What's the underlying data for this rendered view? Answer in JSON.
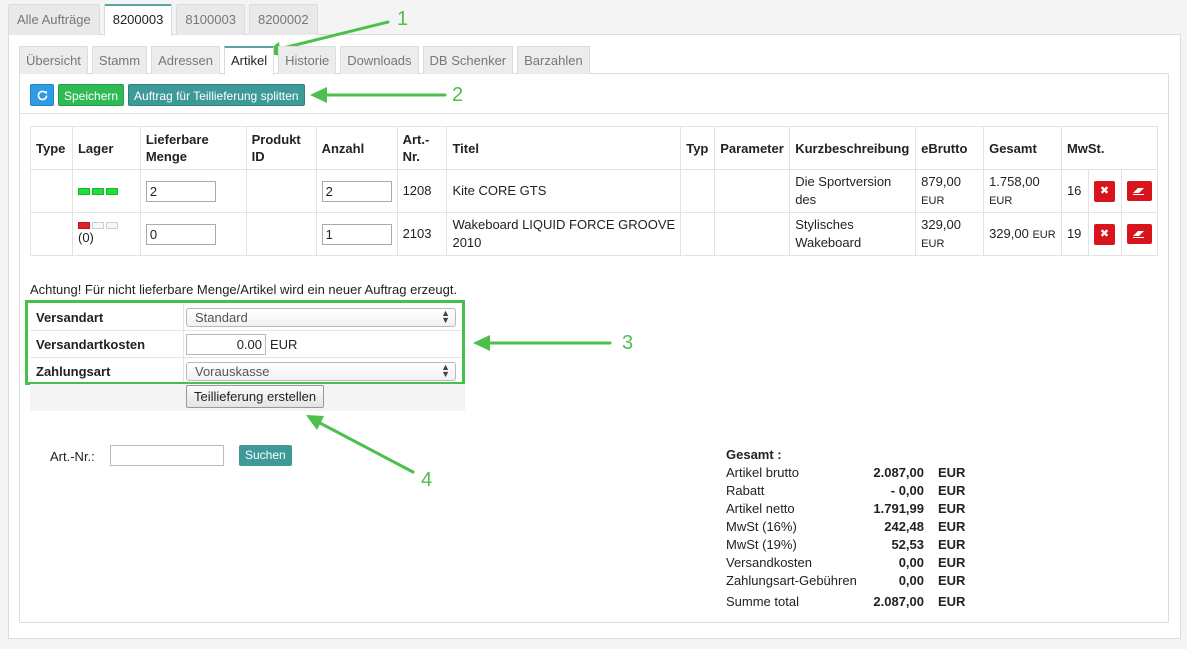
{
  "top_tabs": [
    "Alle Aufträge",
    "8200003",
    "8100003",
    "8200002"
  ],
  "sub_tabs": [
    "Übersicht",
    "Stamm",
    "Adressen",
    "Artikel",
    "Historie",
    "Downloads",
    "DB Schenker",
    "Barzahlen"
  ],
  "toolbar": {
    "save_label": "Speichern",
    "split_label": "Auftrag für Teillieferung splitten",
    "refresh_icon": "refresh-icon"
  },
  "table": {
    "headers": [
      "Type",
      "Lager",
      "Lieferbare Menge",
      "Produkt ID",
      "Anzahl",
      "Art.-Nr.",
      "Titel",
      "Typ",
      "Parameter",
      "Kurzbeschreibung",
      "eBrutto",
      "Gesamt",
      "MwSt."
    ],
    "rows": [
      {
        "lager_text": "",
        "lieferbar": "2",
        "anzahl": "2",
        "artnr": "1208",
        "titel": "Kite CORE GTS",
        "kurz": "Die Sportversion des",
        "ebrutto": "879,00",
        "ebrutto_cur": "EUR",
        "gesamt": "1.758,00",
        "gesamt_cur": "EUR",
        "mwst": "16"
      },
      {
        "lager_text": "(0)",
        "lieferbar": "0",
        "anzahl": "1",
        "artnr": "2103",
        "titel": "Wakeboard LIQUID FORCE GROOVE 2010",
        "kurz": "Stylisches Wakeboard",
        "ebrutto": "329,00",
        "ebrutto_cur": "EUR",
        "gesamt": "329,00",
        "gesamt_cur": "EUR",
        "mwst": "19"
      }
    ]
  },
  "notice": "Achtung! Für nicht lieferbare Menge/Artikel wird ein neuer Auftrag erzeugt.",
  "form": {
    "versandart_label": "Versandart",
    "versandart_value": "Standard",
    "kosten_label": "Versandartkosten",
    "kosten_value": "0.00",
    "kosten_cur": "EUR",
    "zahlungsart_label": "Zahlungsart",
    "zahlungsart_value": "Vorauskasse",
    "create_button": "Teillieferung erstellen"
  },
  "search": {
    "label": "Art.-Nr.:",
    "button": "Suchen",
    "value": ""
  },
  "totals": {
    "head": "Gesamt :",
    "rows": [
      {
        "label": "Artikel brutto",
        "value": "2.087,00",
        "cur": "EUR"
      },
      {
        "label": "Rabatt",
        "value": "- 0,00",
        "cur": "EUR"
      },
      {
        "label": "Artikel netto",
        "value": "1.791,99",
        "cur": "EUR"
      },
      {
        "label": "MwSt (16%)",
        "value": "242,48",
        "cur": "EUR"
      },
      {
        "label": "MwSt (19%)",
        "value": "52,53",
        "cur": "EUR"
      },
      {
        "label": "Versandkosten",
        "value": "0,00",
        "cur": "EUR"
      },
      {
        "label": "Zahlungsart-Gebühren",
        "value": "0,00",
        "cur": "EUR"
      },
      {
        "label": "Summe total",
        "value": "2.087,00",
        "cur": "EUR"
      }
    ]
  },
  "annotations": [
    "1",
    "2",
    "3",
    "4"
  ],
  "colors": {
    "accent": "#3d9a98",
    "save": "#2fba55",
    "refresh": "#2f9be0",
    "danger": "#d9141c",
    "annotation": "#4cbf4c"
  }
}
